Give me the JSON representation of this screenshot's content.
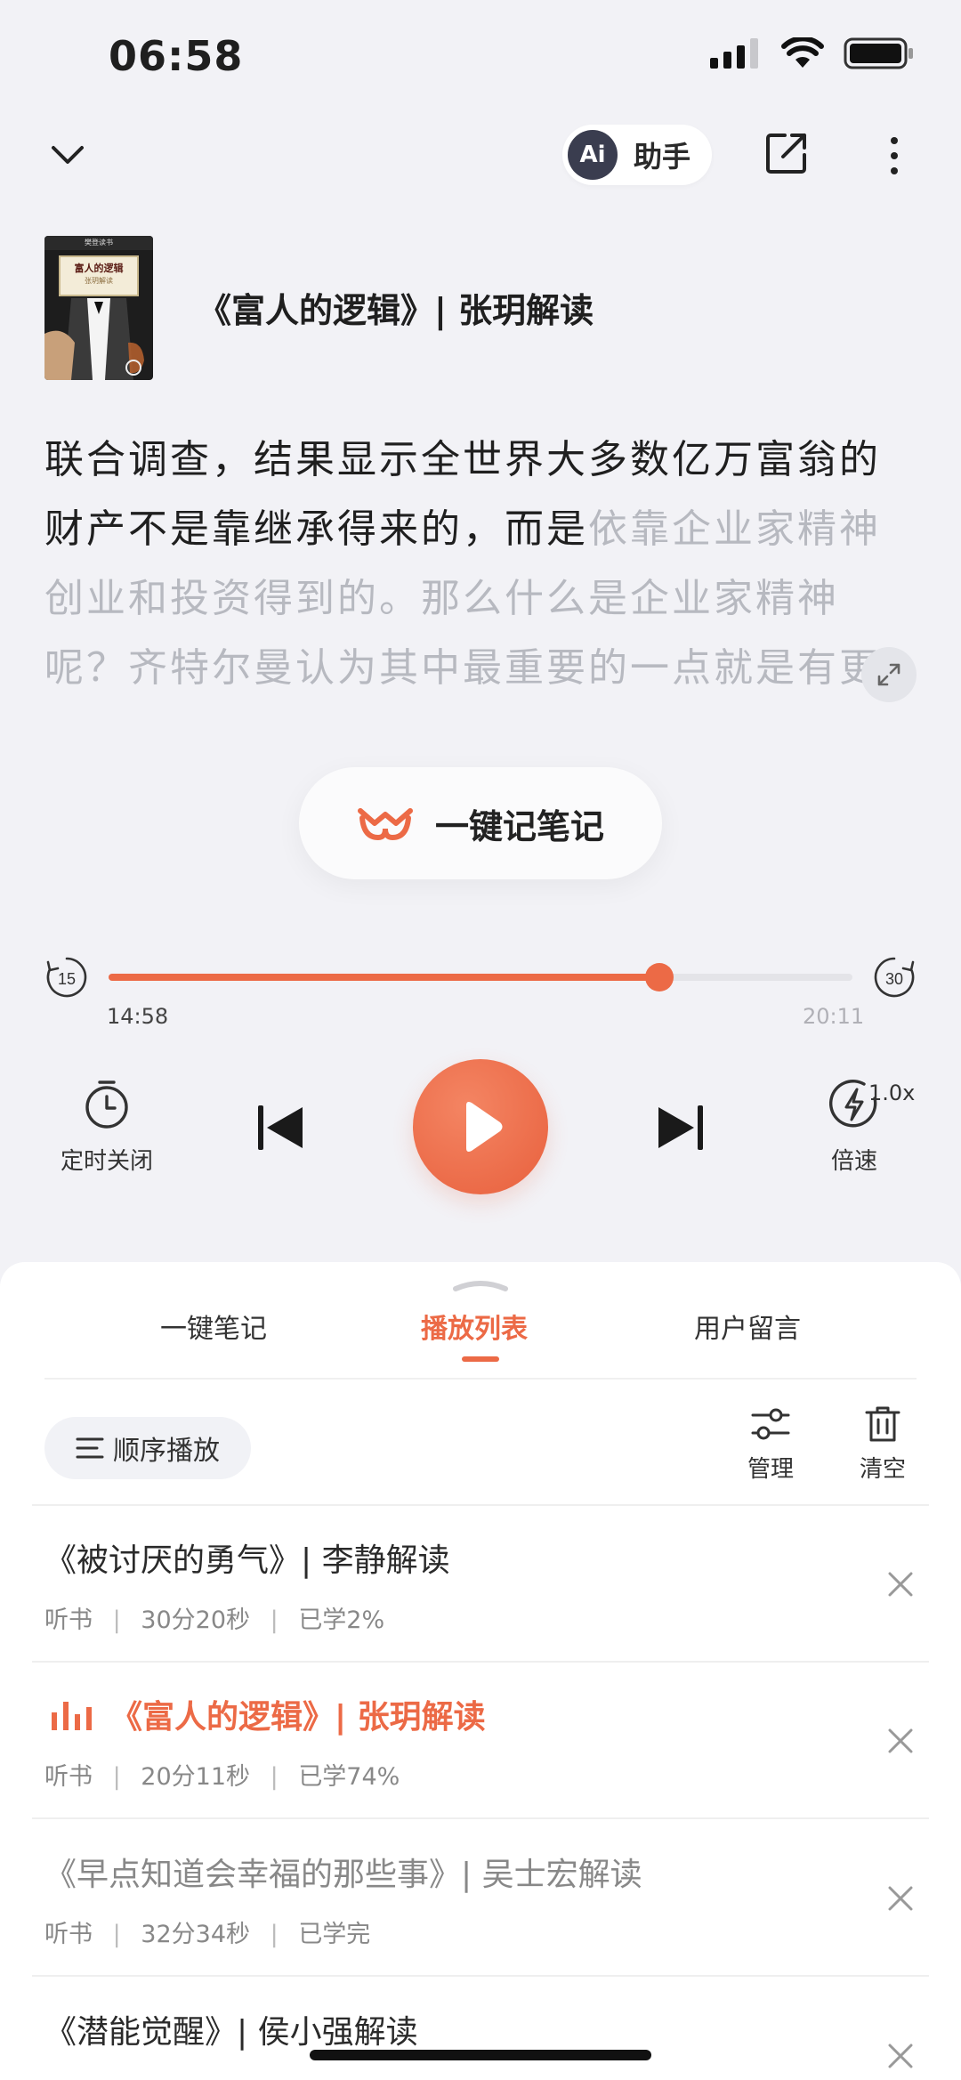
{
  "status_bar": {
    "time": "06:58"
  },
  "top_nav": {
    "ai_badge": "Ai",
    "ai_label": "助手"
  },
  "book": {
    "title": "《富人的逻辑》| 张玥解读",
    "cover_top": "樊登读书",
    "cover_label_line1": "富人的逻辑",
    "cover_label_line2": "张玥解读"
  },
  "transcript": {
    "read": "联合调查，结果显示全世界大多数亿万富翁的财产不是靠继承得来的，而是",
    "unread": "依靠企业家精神创业和投资得到的。那么什么是企业家精神呢？齐特尔曼认为其中最重要的一点就是有更开放的"
  },
  "note_button": {
    "label": "一键记笔记"
  },
  "player": {
    "skip_back": "15",
    "skip_forward": "30",
    "current_time": "14:58",
    "total_time": "20:11",
    "progress": 0.74,
    "timer_label": "定时关闭",
    "speed_label": "倍速",
    "speed_value": "1.0x"
  },
  "tabs": [
    {
      "label": "一键笔记",
      "active": false
    },
    {
      "label": "播放列表",
      "active": true
    },
    {
      "label": "用户留言",
      "active": false
    }
  ],
  "playlist_toolbar": {
    "order_label": "顺序播放",
    "manage_label": "管理",
    "clear_label": "清空"
  },
  "playlist": [
    {
      "title": "《被讨厌的勇气》| 李静解读",
      "type": "听书",
      "duration": "30分20秒",
      "progress": "已学2%",
      "state": "normal"
    },
    {
      "title": "《富人的逻辑》| 张玥解读",
      "type": "听书",
      "duration": "20分11秒",
      "progress": "已学74%",
      "state": "playing"
    },
    {
      "title": "《早点知道会幸福的那些事》| 吴士宏解读",
      "type": "听书",
      "duration": "32分34秒",
      "progress": "已学完",
      "state": "done"
    },
    {
      "title": "《潜能觉醒》| 侯小强解读",
      "type": "听书",
      "duration": "",
      "progress": "",
      "state": "normal"
    }
  ],
  "colors": {
    "accent": "#ec6a46",
    "background": "#f2f2f6",
    "faded_text": "#b7b9c0"
  }
}
